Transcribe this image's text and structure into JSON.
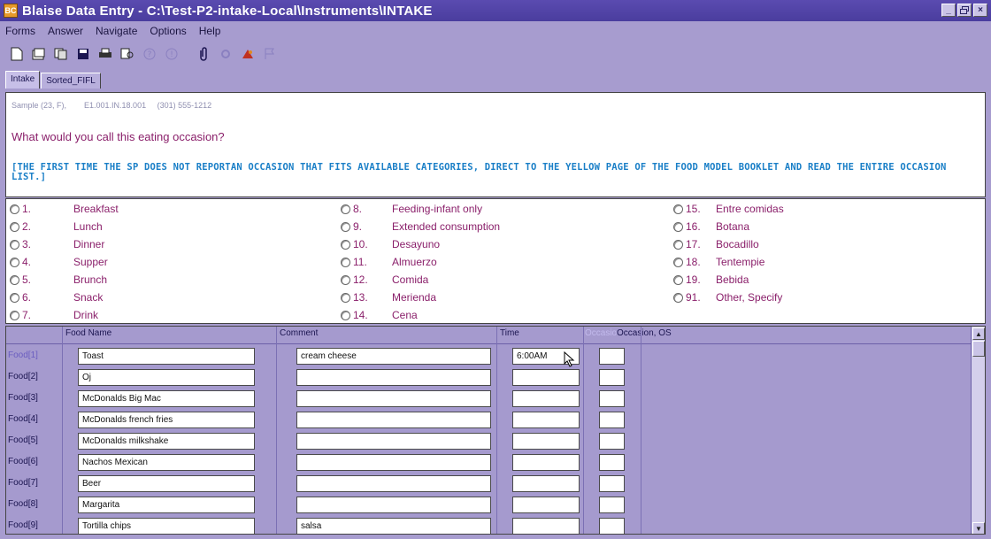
{
  "window": {
    "icon_text": "BC",
    "title": "Blaise Data Entry - C:\\Test-P2-intake-Local\\Instruments\\INTAKE",
    "controls": [
      "_",
      "×"
    ]
  },
  "menu": [
    "Forms",
    "Answer",
    "Navigate",
    "Options",
    "Help"
  ],
  "toolbar": {
    "icons": [
      "new-icon",
      "open-icon",
      "copy-icon",
      "save-icon",
      "print-icon",
      "search-icon",
      "help-icon",
      "info-icon",
      "attach-icon",
      "settings-icon",
      "record-icon",
      "flag-icon"
    ]
  },
  "tabs": [
    "Intake",
    "Sorted_FIFL"
  ],
  "question": {
    "sample_line": "Sample (23, F),        E1.001.IN.18.001     (301) 555-1212",
    "text": "What would you call this eating occasion?",
    "instruction": "[THE FIRST TIME THE SP DOES NOT REPORTAN OCCASION THAT FITS AVAILABLE CATEGORIES, DIRECT  TO THE YELLOW PAGE OF THE FOOD MODEL BOOKLET AND READ THE ENTIRE OCCASION LIST.]"
  },
  "answers": [
    {
      "num": "1.",
      "label": "Breakfast"
    },
    {
      "num": "2.",
      "label": "Lunch"
    },
    {
      "num": "3.",
      "label": "Dinner"
    },
    {
      "num": "4.",
      "label": "Supper"
    },
    {
      "num": "5.",
      "label": "Brunch"
    },
    {
      "num": "6.",
      "label": "Snack"
    },
    {
      "num": "7.",
      "label": "Drink"
    },
    {
      "num": "8.",
      "label": "Feeding-infant only"
    },
    {
      "num": "9.",
      "label": "Extended consumption"
    },
    {
      "num": "10.",
      "label": "Desayuno"
    },
    {
      "num": "11.",
      "label": "Almuerzo"
    },
    {
      "num": "12.",
      "label": "Comida"
    },
    {
      "num": "13.",
      "label": "Merienda"
    },
    {
      "num": "14.",
      "label": "Cena"
    },
    {
      "num": "15.",
      "label": "Entre comidas"
    },
    {
      "num": "16.",
      "label": "Botana"
    },
    {
      "num": "17.",
      "label": "Bocadillo"
    },
    {
      "num": "18.",
      "label": "Tentempie"
    },
    {
      "num": "19.",
      "label": "Bebida"
    },
    {
      "num": "91.",
      "label": "Other, Specify"
    }
  ],
  "grid": {
    "headers": {
      "food_name": "Food Name",
      "comment": "Comment",
      "time": "Time",
      "occasion": "Occasion",
      "occasion_os": "Occasion, OS"
    },
    "rows": [
      {
        "label": "Food[1]",
        "food": "Toast",
        "comment": "cream cheese",
        "time": "6:00AM",
        "occasion": ""
      },
      {
        "label": "Food[2]",
        "food": "Oj",
        "comment": "",
        "time": "",
        "occasion": ""
      },
      {
        "label": "Food[3]",
        "food": "McDonalds Big Mac",
        "comment": "",
        "time": "",
        "occasion": ""
      },
      {
        "label": "Food[4]",
        "food": "McDonalds french fries",
        "comment": "",
        "time": "",
        "occasion": ""
      },
      {
        "label": "Food[5]",
        "food": "McDonalds milkshake",
        "comment": "",
        "time": "",
        "occasion": ""
      },
      {
        "label": "Food[6]",
        "food": "Nachos Mexican",
        "comment": "",
        "time": "",
        "occasion": ""
      },
      {
        "label": "Food[7]",
        "food": "Beer",
        "comment": "",
        "time": "",
        "occasion": ""
      },
      {
        "label": "Food[8]",
        "food": "Margarita",
        "comment": "",
        "time": "",
        "occasion": ""
      },
      {
        "label": "Food[9]",
        "food": "Tortilla chips",
        "comment": "salsa",
        "time": "",
        "occasion": ""
      }
    ]
  },
  "colors": {
    "background": "#a79ccf",
    "title_bar": "#4a3d9e",
    "question_text": "#8a1f6a",
    "instruction_text": "#1a7fc7"
  }
}
